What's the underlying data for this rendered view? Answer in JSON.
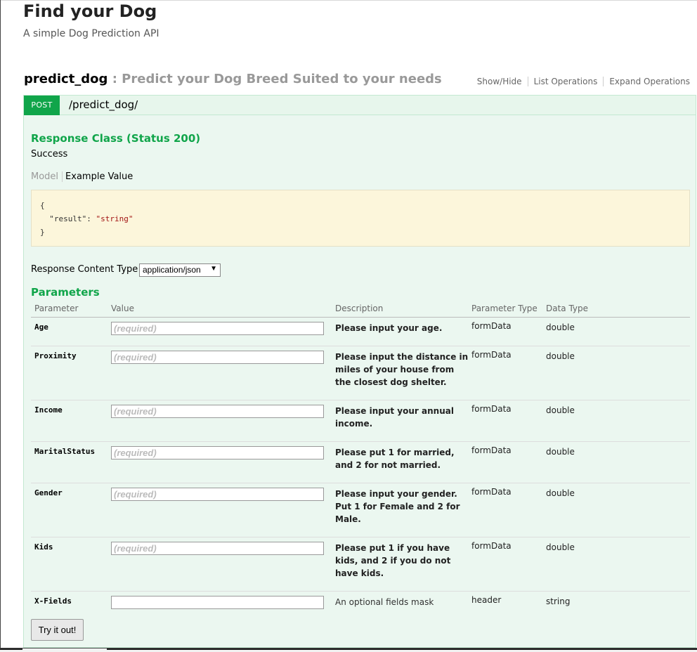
{
  "api": {
    "title": "Find your Dog",
    "description": "A simple Dog Prediction API"
  },
  "resource": {
    "name": "predict_dog",
    "separator": " : ",
    "description": "Predict your Dog Breed Suited to your needs",
    "links": [
      "Show/Hide",
      "List Operations",
      "Expand Operations"
    ]
  },
  "operation": {
    "method": "POST",
    "path": "/predict_dog/",
    "response_class_title": "Response Class (Status 200)",
    "response_class_status": "Success",
    "tabs": {
      "model": "Model",
      "example": "Example Value"
    },
    "example": {
      "open": "{",
      "key": "\"result\"",
      "colon": ": ",
      "value": "\"string\"",
      "close": "}"
    },
    "response_content_type_label": "Response Content Type",
    "response_content_type_value": "application/json",
    "parameters_title": "Parameters",
    "parameter_headers": {
      "parameter": "Parameter",
      "value": "Value",
      "description": "Description",
      "parameter_type": "Parameter Type",
      "data_type": "Data Type"
    },
    "parameters": [
      {
        "name": "Age",
        "placeholder": "(required)",
        "description": "Please input your age.",
        "param_type": "formData",
        "data_type": "double"
      },
      {
        "name": "Proximity",
        "placeholder": "(required)",
        "description": "Please input the distance in miles of your house from the closest dog shelter.",
        "param_type": "formData",
        "data_type": "double"
      },
      {
        "name": "Income",
        "placeholder": "(required)",
        "description": "Please input your annual income.",
        "param_type": "formData",
        "data_type": "double"
      },
      {
        "name": "MaritalStatus",
        "placeholder": "(required)",
        "description": "Please put 1 for married, and 2 for not married.",
        "param_type": "formData",
        "data_type": "double"
      },
      {
        "name": "Gender",
        "placeholder": "(required)",
        "description": "Please input your gender. Put 1 for Female and 2 for Male.",
        "param_type": "formData",
        "data_type": "double"
      },
      {
        "name": "Kids",
        "placeholder": "(required)",
        "description": "Please put 1 if you have kids, and 2 if you do not have kids.",
        "param_type": "formData",
        "data_type": "double"
      },
      {
        "name": "X-Fields",
        "placeholder": "",
        "description": "An optional fields mask",
        "param_type": "header",
        "data_type": "string"
      }
    ],
    "try_button": "Try it out!"
  }
}
